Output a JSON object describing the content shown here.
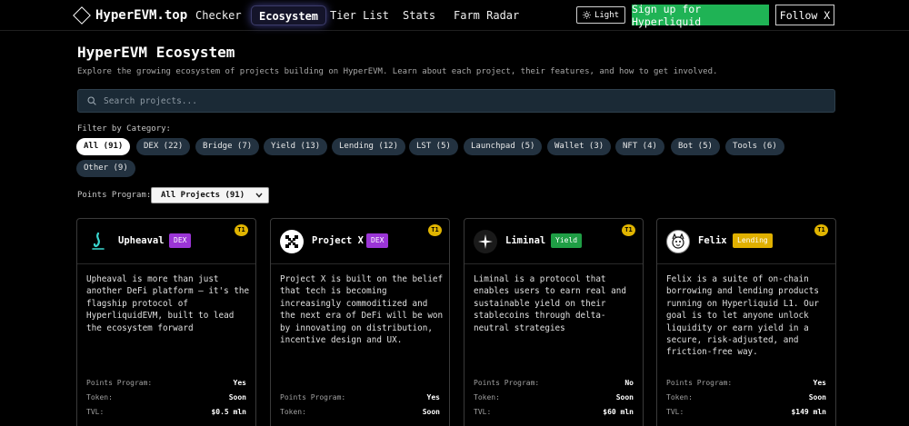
{
  "nav": {
    "logo": "HyperEVM.top",
    "links": [
      "Checker",
      "Ecosystem",
      "Tier List",
      "Stats",
      "Farm Radar"
    ],
    "light_label": "Light",
    "signup_label": "Sign up for Hyperliquid",
    "follow_label": "Follow X"
  },
  "header": {
    "title": "HyperEVM Ecosystem",
    "subtitle": "Explore the growing ecosystem of projects building on HyperEVM. Learn about each project, their features, and how to get involved."
  },
  "search": {
    "placeholder": "Search projects..."
  },
  "filter": {
    "label": "Filter by Category:",
    "chips": [
      "All (91)",
      "DEX (22)",
      "Bridge (7)",
      "Yield (13)",
      "Lending (12)",
      "LST (5)",
      "Launchpad (5)",
      "Wallet (3)",
      "NFT (4)",
      "Bot (5)",
      "Tools (6)",
      "Other (9)"
    ]
  },
  "points": {
    "label": "Points Program:",
    "selected": "All Projects (91)"
  },
  "cards": [
    {
      "name": "Upheaval",
      "badge": "DEX",
      "badge_color": "#9b35d6",
      "tier": "T1",
      "logo_icon": "upheaval-logo-icon",
      "desc": "Upheaval is more than just another DeFi platform – it's the flagship protocol of HyperliquidEVM, built to lead the ecosystem forward",
      "points_label": "Points Program:",
      "points": "Yes",
      "token_label": "Token:",
      "token": "Soon",
      "tvl_label": "TVL:",
      "tvl": "$0.5 mln"
    },
    {
      "name": "Project X",
      "badge": "DEX",
      "badge_color": "#9b35d6",
      "tier": "T1",
      "logo_icon": "project-x-logo-icon",
      "desc": "Project X is built on the belief that tech is becoming increasingly commoditized and the next era of DeFi will be won by innovating on distribution, incentive design and UX.",
      "points_label": "Points Program:",
      "points": "Yes",
      "token_label": "Token:",
      "token": "Soon"
    },
    {
      "name": "Liminal",
      "badge": "Yield",
      "badge_color": "#1f9e45",
      "tier": "T1",
      "logo_icon": "liminal-logo-icon",
      "desc": "Liminal is a protocol that enables users to earn real and sustainable yield on their stablecoins through delta-neutral strategies",
      "points_label": "Points Program:",
      "points": "No",
      "token_label": "Token:",
      "token": "Soon",
      "tvl_label": "TVL:",
      "tvl": "$60 mln"
    },
    {
      "name": "Felix",
      "badge": "Lending",
      "badge_color": "#e0b000",
      "tier": "T1",
      "logo_icon": "felix-logo-icon",
      "desc": "Felix is a suite of on-chain borrowing and lending products running on Hyperliquid L1. Our goal is to let anyone unlock liquidity or earn yield in a secure, risk-adjusted, and friction-free way.",
      "points_label": "Points Program:",
      "points": "Yes",
      "token_label": "Token:",
      "token": "Soon",
      "tvl_label": "TVL:",
      "tvl": "$149 mln"
    }
  ]
}
